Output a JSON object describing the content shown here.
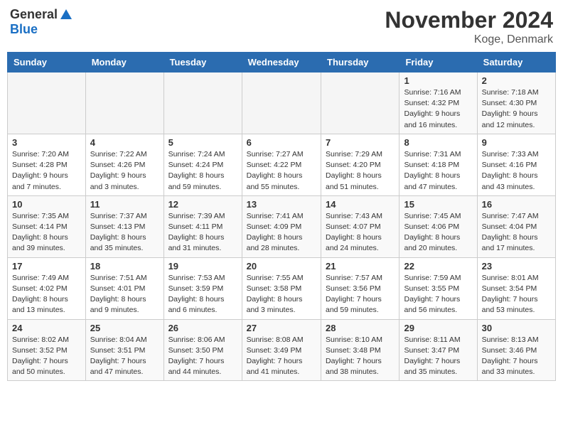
{
  "header": {
    "logo_general": "General",
    "logo_blue": "Blue",
    "month": "November 2024",
    "location": "Koge, Denmark"
  },
  "days_of_week": [
    "Sunday",
    "Monday",
    "Tuesday",
    "Wednesday",
    "Thursday",
    "Friday",
    "Saturday"
  ],
  "weeks": [
    [
      {
        "day": "",
        "info": ""
      },
      {
        "day": "",
        "info": ""
      },
      {
        "day": "",
        "info": ""
      },
      {
        "day": "",
        "info": ""
      },
      {
        "day": "",
        "info": ""
      },
      {
        "day": "1",
        "info": "Sunrise: 7:16 AM\nSunset: 4:32 PM\nDaylight: 9 hours and 16 minutes."
      },
      {
        "day": "2",
        "info": "Sunrise: 7:18 AM\nSunset: 4:30 PM\nDaylight: 9 hours and 12 minutes."
      }
    ],
    [
      {
        "day": "3",
        "info": "Sunrise: 7:20 AM\nSunset: 4:28 PM\nDaylight: 9 hours and 7 minutes."
      },
      {
        "day": "4",
        "info": "Sunrise: 7:22 AM\nSunset: 4:26 PM\nDaylight: 9 hours and 3 minutes."
      },
      {
        "day": "5",
        "info": "Sunrise: 7:24 AM\nSunset: 4:24 PM\nDaylight: 8 hours and 59 minutes."
      },
      {
        "day": "6",
        "info": "Sunrise: 7:27 AM\nSunset: 4:22 PM\nDaylight: 8 hours and 55 minutes."
      },
      {
        "day": "7",
        "info": "Sunrise: 7:29 AM\nSunset: 4:20 PM\nDaylight: 8 hours and 51 minutes."
      },
      {
        "day": "8",
        "info": "Sunrise: 7:31 AM\nSunset: 4:18 PM\nDaylight: 8 hours and 47 minutes."
      },
      {
        "day": "9",
        "info": "Sunrise: 7:33 AM\nSunset: 4:16 PM\nDaylight: 8 hours and 43 minutes."
      }
    ],
    [
      {
        "day": "10",
        "info": "Sunrise: 7:35 AM\nSunset: 4:14 PM\nDaylight: 8 hours and 39 minutes."
      },
      {
        "day": "11",
        "info": "Sunrise: 7:37 AM\nSunset: 4:13 PM\nDaylight: 8 hours and 35 minutes."
      },
      {
        "day": "12",
        "info": "Sunrise: 7:39 AM\nSunset: 4:11 PM\nDaylight: 8 hours and 31 minutes."
      },
      {
        "day": "13",
        "info": "Sunrise: 7:41 AM\nSunset: 4:09 PM\nDaylight: 8 hours and 28 minutes."
      },
      {
        "day": "14",
        "info": "Sunrise: 7:43 AM\nSunset: 4:07 PM\nDaylight: 8 hours and 24 minutes."
      },
      {
        "day": "15",
        "info": "Sunrise: 7:45 AM\nSunset: 4:06 PM\nDaylight: 8 hours and 20 minutes."
      },
      {
        "day": "16",
        "info": "Sunrise: 7:47 AM\nSunset: 4:04 PM\nDaylight: 8 hours and 17 minutes."
      }
    ],
    [
      {
        "day": "17",
        "info": "Sunrise: 7:49 AM\nSunset: 4:02 PM\nDaylight: 8 hours and 13 minutes."
      },
      {
        "day": "18",
        "info": "Sunrise: 7:51 AM\nSunset: 4:01 PM\nDaylight: 8 hours and 9 minutes."
      },
      {
        "day": "19",
        "info": "Sunrise: 7:53 AM\nSunset: 3:59 PM\nDaylight: 8 hours and 6 minutes."
      },
      {
        "day": "20",
        "info": "Sunrise: 7:55 AM\nSunset: 3:58 PM\nDaylight: 8 hours and 3 minutes."
      },
      {
        "day": "21",
        "info": "Sunrise: 7:57 AM\nSunset: 3:56 PM\nDaylight: 7 hours and 59 minutes."
      },
      {
        "day": "22",
        "info": "Sunrise: 7:59 AM\nSunset: 3:55 PM\nDaylight: 7 hours and 56 minutes."
      },
      {
        "day": "23",
        "info": "Sunrise: 8:01 AM\nSunset: 3:54 PM\nDaylight: 7 hours and 53 minutes."
      }
    ],
    [
      {
        "day": "24",
        "info": "Sunrise: 8:02 AM\nSunset: 3:52 PM\nDaylight: 7 hours and 50 minutes."
      },
      {
        "day": "25",
        "info": "Sunrise: 8:04 AM\nSunset: 3:51 PM\nDaylight: 7 hours and 47 minutes."
      },
      {
        "day": "26",
        "info": "Sunrise: 8:06 AM\nSunset: 3:50 PM\nDaylight: 7 hours and 44 minutes."
      },
      {
        "day": "27",
        "info": "Sunrise: 8:08 AM\nSunset: 3:49 PM\nDaylight: 7 hours and 41 minutes."
      },
      {
        "day": "28",
        "info": "Sunrise: 8:10 AM\nSunset: 3:48 PM\nDaylight: 7 hours and 38 minutes."
      },
      {
        "day": "29",
        "info": "Sunrise: 8:11 AM\nSunset: 3:47 PM\nDaylight: 7 hours and 35 minutes."
      },
      {
        "day": "30",
        "info": "Sunrise: 8:13 AM\nSunset: 3:46 PM\nDaylight: 7 hours and 33 minutes."
      }
    ]
  ]
}
